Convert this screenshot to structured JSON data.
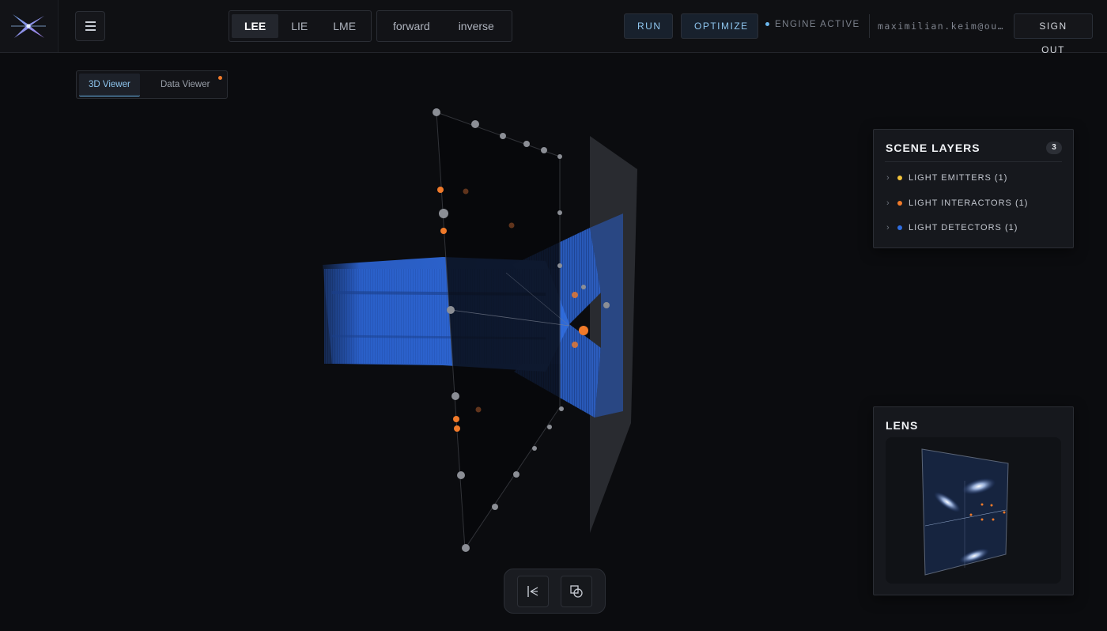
{
  "header": {
    "modes": [
      "LEE",
      "LIE",
      "LME"
    ],
    "active_mode": "LEE",
    "directions": [
      "forward",
      "inverse"
    ],
    "run_label": "RUN",
    "optimize_label": "OPTIMIZE",
    "status_label": "ENGINE ACTIVE",
    "user_email": "maximilian.keim@ou…",
    "signout_label": "SIGN OUT"
  },
  "viewer": {
    "tabs": [
      "3D Viewer",
      "Data Viewer"
    ],
    "active_tab": "3D Viewer"
  },
  "scene_layers": {
    "title": "SCENE LAYERS",
    "count": "3",
    "items": [
      {
        "label": "LIGHT EMITTERS (1)",
        "color": "#f2c23a"
      },
      {
        "label": "LIGHT INTERACTORS (1)",
        "color": "#f07a2a"
      },
      {
        "label": "LIGHT DETECTORS (1)",
        "color": "#2f6de0"
      }
    ]
  },
  "lens": {
    "title": "LENS"
  },
  "colors": {
    "accent": "#8fc6ef",
    "beam": "#2f6ad8",
    "interactor_point": "#f07a2a"
  },
  "toolbar": {
    "icons": [
      "align-left-icon",
      "shapes-icon"
    ]
  }
}
